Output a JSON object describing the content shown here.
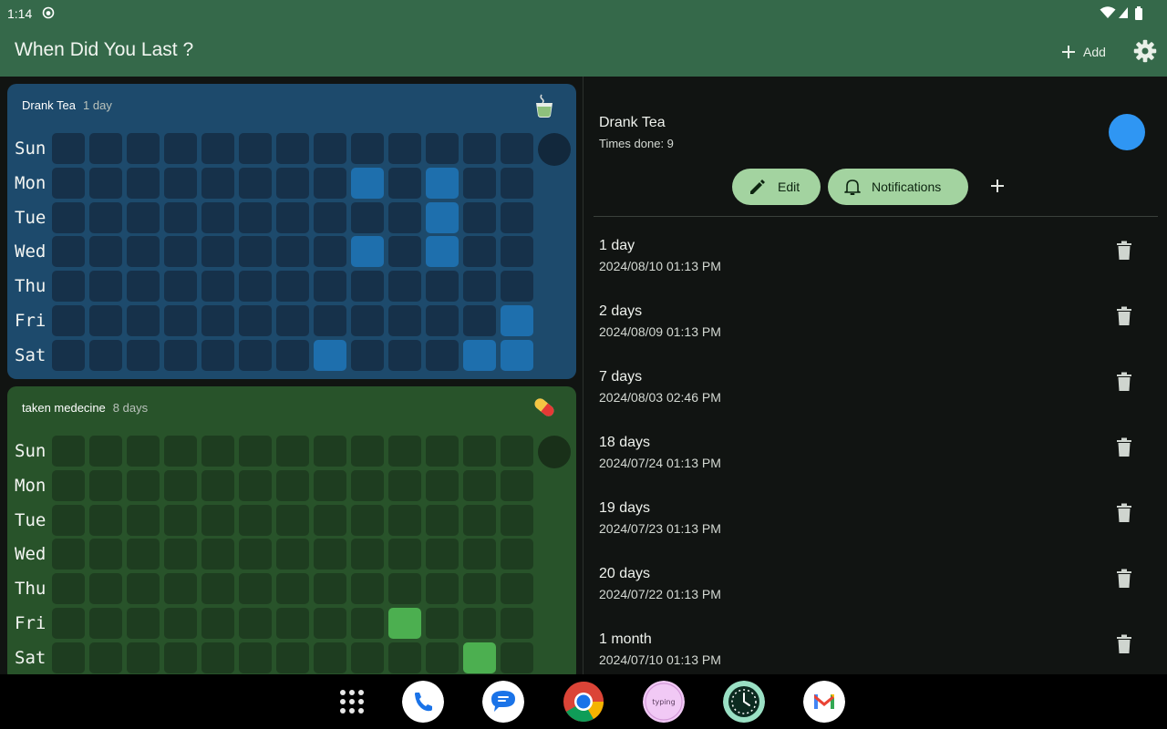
{
  "status": {
    "time": "1:14"
  },
  "appbar": {
    "title": "When Did You Last ?",
    "add_label": "Add"
  },
  "habits": [
    {
      "name": "Drank Tea",
      "since": "1 day",
      "icon": "tea-cup-icon",
      "colors": {
        "card": "#1d4a6c",
        "empty": "#16314a",
        "filled": "#1e6fad",
        "circle": "#12283c"
      },
      "days": [
        "Sun",
        "Mon",
        "Tue",
        "Wed",
        "Thu",
        "Fri",
        "Sat"
      ],
      "grid_filled": [
        [
          0,
          0,
          0,
          0,
          0,
          0,
          0,
          0,
          0,
          0,
          0,
          0,
          0
        ],
        [
          0,
          0,
          0,
          0,
          0,
          0,
          0,
          0,
          1,
          0,
          1,
          0,
          0
        ],
        [
          0,
          0,
          0,
          0,
          0,
          0,
          0,
          0,
          0,
          0,
          1,
          0,
          0
        ],
        [
          0,
          0,
          0,
          0,
          0,
          0,
          0,
          0,
          1,
          0,
          1,
          0,
          0
        ],
        [
          0,
          0,
          0,
          0,
          0,
          0,
          0,
          0,
          0,
          0,
          0,
          0,
          0
        ],
        [
          0,
          0,
          0,
          0,
          0,
          0,
          0,
          0,
          0,
          0,
          0,
          0,
          1
        ],
        [
          0,
          0,
          0,
          0,
          0,
          0,
          0,
          1,
          0,
          0,
          0,
          1,
          1
        ]
      ]
    },
    {
      "name": "taken medecine",
      "since": "8 days",
      "icon": "pill-icon",
      "colors": {
        "card": "#28532a",
        "empty": "#1e3d20",
        "filled": "#4caf50",
        "circle": "#193019"
      },
      "days": [
        "Sun",
        "Mon",
        "Tue",
        "Wed",
        "Thu",
        "Fri",
        "Sat"
      ],
      "grid_filled": [
        [
          0,
          0,
          0,
          0,
          0,
          0,
          0,
          0,
          0,
          0,
          0,
          0,
          0
        ],
        [
          0,
          0,
          0,
          0,
          0,
          0,
          0,
          0,
          0,
          0,
          0,
          0,
          0
        ],
        [
          0,
          0,
          0,
          0,
          0,
          0,
          0,
          0,
          0,
          0,
          0,
          0,
          0
        ],
        [
          0,
          0,
          0,
          0,
          0,
          0,
          0,
          0,
          0,
          0,
          0,
          0,
          0
        ],
        [
          0,
          0,
          0,
          0,
          0,
          0,
          0,
          0,
          0,
          0,
          0,
          0,
          0
        ],
        [
          0,
          0,
          0,
          0,
          0,
          0,
          0,
          0,
          0,
          1,
          0,
          0,
          0
        ],
        [
          0,
          0,
          0,
          0,
          0,
          0,
          0,
          0,
          0,
          0,
          0,
          1,
          0
        ]
      ]
    }
  ],
  "detail": {
    "name": "Drank Tea",
    "times_done": "Times done: 9",
    "color": "#2f96f3",
    "edit_label": "Edit",
    "notifications_label": "Notifications",
    "entries": [
      {
        "ago": "1 day",
        "date": "2024/08/10 01:13 PM"
      },
      {
        "ago": "2 days",
        "date": "2024/08/09 01:13 PM"
      },
      {
        "ago": "7 days",
        "date": "2024/08/03 02:46 PM"
      },
      {
        "ago": "18 days",
        "date": "2024/07/24 01:13 PM"
      },
      {
        "ago": "19 days",
        "date": "2024/07/23 01:13 PM"
      },
      {
        "ago": "20 days",
        "date": "2024/07/22 01:13 PM"
      },
      {
        "ago": "1 month",
        "date": "2024/07/10 01:13 PM"
      }
    ]
  },
  "dock": {
    "apps": [
      {
        "name": "app-drawer-icon"
      },
      {
        "name": "phone-app-icon"
      },
      {
        "name": "messages-app-icon"
      },
      {
        "name": "chrome-app-icon"
      },
      {
        "name": "typing-app-icon",
        "label": "typing"
      },
      {
        "name": "clock-app-icon"
      },
      {
        "name": "gmail-app-icon"
      }
    ]
  }
}
